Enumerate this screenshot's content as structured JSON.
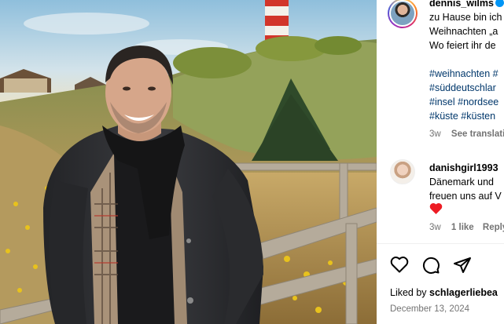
{
  "post": {
    "username": "dennis_wilms",
    "caption_lines": [
      "zu Hause bin ich",
      "Weihnachten „a",
      "Wo feiert ihr de"
    ],
    "hashtags": [
      "#weihnachten #",
      "#süddeutschlar",
      "#insel #nordsee",
      "#küste #küsten"
    ],
    "age": "3w",
    "see_translation": "See translati"
  },
  "comment": {
    "username": "danishgirl1993",
    "lines": [
      "Dänemark und",
      "freuen uns auf V"
    ],
    "age": "3w",
    "likes": "1 like",
    "reply": "Reply"
  },
  "actions": {
    "like_icon": "heart-icon",
    "comment_icon": "comment-icon",
    "share_icon": "share-icon"
  },
  "likes_summary": {
    "prefix": "Liked by ",
    "user": "schlagerliebea"
  },
  "date": "December 13, 2024",
  "colors": {
    "hashtag": "#00376b",
    "muted": "#737373",
    "verified": "#0095f6",
    "heart": "#ed1c24"
  }
}
